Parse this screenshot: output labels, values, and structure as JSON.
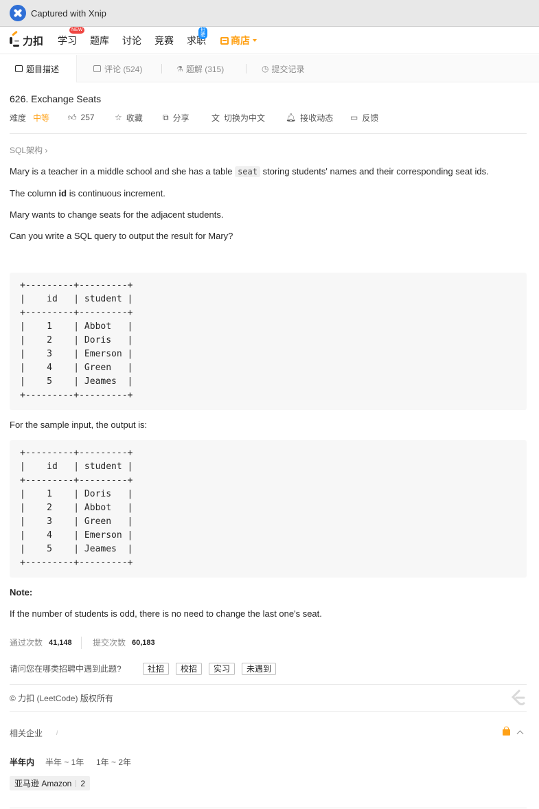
{
  "titlebar": {
    "title": "Captured with Xnip",
    "icon": "xnip-icon"
  },
  "topnav": {
    "logo_text": "力扣",
    "items": [
      {
        "label": "学习",
        "badge": "NEW"
      },
      {
        "label": "题库"
      },
      {
        "label": "讨论"
      },
      {
        "label": "竞赛"
      },
      {
        "label": "求职",
        "badge": "招聘"
      }
    ],
    "store_label": "商店"
  },
  "tabs": [
    {
      "label": "题目描述",
      "icon": "description-icon",
      "active": true
    },
    {
      "label": "评论 (524)",
      "icon": "comment-icon"
    },
    {
      "label": "题解 (315)",
      "icon": "flask-icon"
    },
    {
      "label": "提交记录",
      "icon": "clock-icon"
    }
  ],
  "question": {
    "title": "626. Exchange Seats",
    "difficulty_label": "难度",
    "difficulty_value": "中等",
    "likes": "257",
    "actions": {
      "favorite": "收藏",
      "share": "分享",
      "switch_lang": "切换为中文",
      "notify": "接收动态",
      "feedback": "反馈"
    },
    "breadcrumb": "SQL架构",
    "p1_before": "Mary is a teacher in a middle school and she has a table ",
    "p1_code": "seat",
    "p1_after": " storing students' names and their corresponding seat ids.",
    "p2_before": "The column ",
    "p2_bold": "id",
    "p2_after": " is continuous increment.",
    "p3": "Mary wants to change seats for the adjacent students.",
    "p4": "Can you write a SQL query to output the result for Mary?",
    "table_input": "+---------+---------+\n|    id   | student |\n+---------+---------+\n|    1    | Abbot   |\n|    2    | Doris   |\n|    3    | Emerson |\n|    4    | Green   |\n|    5    | Jeames  |\n+---------+---------+",
    "sample_text": "For the sample input, the output is:",
    "table_output": "+---------+---------+\n|    id   | student |\n+---------+---------+\n|    1    | Doris   |\n|    2    | Abbot   |\n|    3    | Green   |\n|    4    | Emerson |\n|    5    | Jeames  |\n+---------+---------+",
    "note_title": "Note:",
    "note_text": "If the number of students is odd, there is no need to change the last one's seat."
  },
  "stats": {
    "accepted_label": "通过次数",
    "accepted_value": "41,148",
    "submitted_label": "提交次数",
    "submitted_value": "60,183"
  },
  "survey": {
    "question": "请问您在哪类招聘中遇到此题?",
    "options": [
      "社招",
      "校招",
      "实习",
      "未遇到"
    ]
  },
  "copyright": "© 力扣 (LeetCode) 版权所有",
  "companies": {
    "heading": "相关企业",
    "info_icon": "i",
    "periods": [
      "半年内",
      "半年 ~ 1年",
      "1年 ~ 2年"
    ],
    "tags": [
      {
        "name": "亚马逊 Amazon",
        "count": "2"
      }
    ]
  }
}
